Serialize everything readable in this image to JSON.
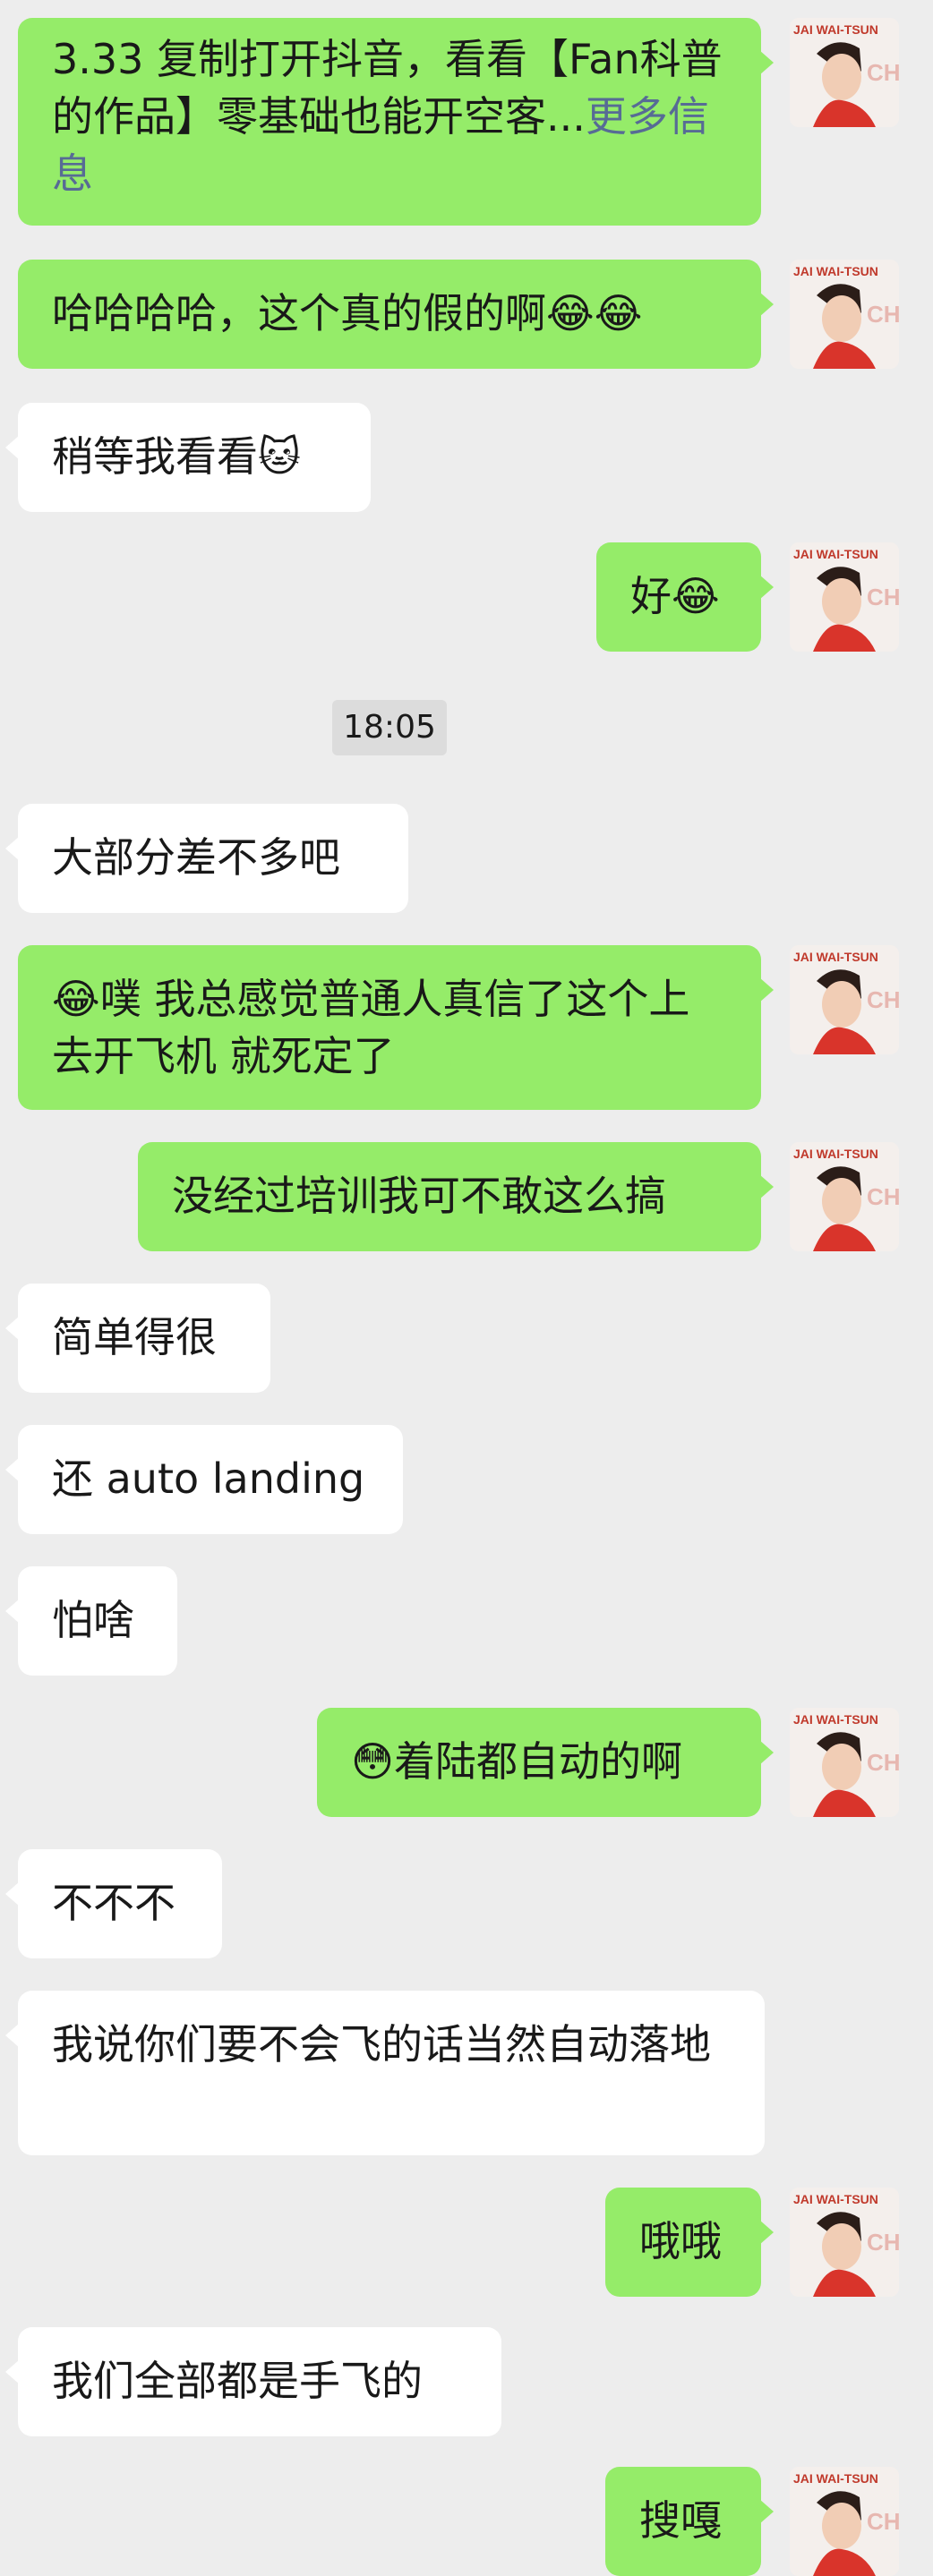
{
  "timestamp": "18:05",
  "messages": [
    {
      "side": "me",
      "text": "3.33 复制打开抖音，看看【Fan科普的作品】零基础也能开空客...",
      "link": "更多信息"
    },
    {
      "side": "me",
      "text": "哈哈哈哈，这个真的假的啊😂😂"
    },
    {
      "side": "other",
      "text": "稍等我看看🐱"
    },
    {
      "side": "me",
      "text": "好😂"
    },
    {
      "side": "other",
      "text": "大部分差不多吧"
    },
    {
      "side": "me",
      "text": "😂噗 我总感觉普通人真信了这个上去开飞机 就死定了"
    },
    {
      "side": "me",
      "text": "没经过培训我可不敢这么搞"
    },
    {
      "side": "other",
      "text": "简单得很"
    },
    {
      "side": "other",
      "text": "还 auto landing"
    },
    {
      "side": "other",
      "text": "怕啥"
    },
    {
      "side": "me",
      "text": "😳着陆都自动的啊"
    },
    {
      "side": "other",
      "text": "不不不"
    },
    {
      "side": "other",
      "text": "我说你们要不会飞的话当然自动落地"
    },
    {
      "side": "me",
      "text": "哦哦"
    },
    {
      "side": "other",
      "text": "我们全部都是手飞的"
    },
    {
      "side": "me",
      "text": "搜嘎"
    }
  ],
  "avatar": {
    "caption": "JAI WAI-TSUN",
    "side_text": "CHI"
  }
}
